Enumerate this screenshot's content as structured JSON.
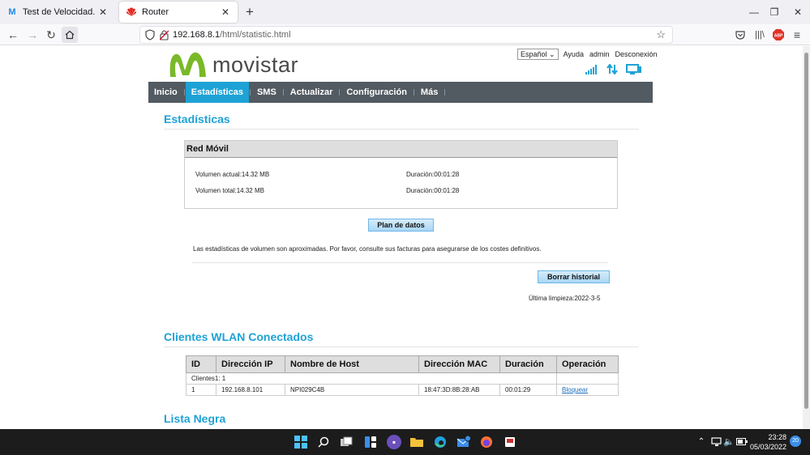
{
  "browser": {
    "tabs": [
      {
        "title": "Test de Velocidad. Comprueba",
        "active": false
      },
      {
        "title": "Router",
        "active": true
      }
    ],
    "url_host": "192.168.8.1",
    "url_path": "/html/statistic.html",
    "new_tab_glyph": "+",
    "close_glyph": "✕"
  },
  "header": {
    "logo_text": "movistar",
    "language": "Español",
    "links": [
      "Ayuda",
      "admin",
      "Desconexión"
    ]
  },
  "menu": {
    "items": [
      "Inicio",
      "Estadísticas",
      "SMS",
      "Actualizar",
      "Configuración",
      "Más"
    ],
    "active_index": 1
  },
  "stats": {
    "section_title": "Estadísticas",
    "box_title": "Red Móvil",
    "current_volume": "Volumen actual:14.32 MB",
    "current_duration": "Duración:00:01:28",
    "total_volume": "Volumen total:14.32 MB",
    "total_duration": "Duración:00:01:28",
    "plan_button": "Plan de datos",
    "note": "Las estadísticas de volumen son aproximadas. Por favor, consulte sus facturas para asegurarse de los costes definitivos.",
    "clear_button": "Borrar historial",
    "last_clean": "Última limpieza:2022-3-5"
  },
  "clients": {
    "section_title": "Clientes WLAN Conectados",
    "headers": [
      "ID",
      "Dirección IP",
      "Nombre de Host",
      "Dirección MAC",
      "Duración",
      "Operación"
    ],
    "summary": "Clientes1: 1",
    "rows": [
      {
        "id": "1",
        "ip": "192.168.8.101",
        "host": "NPI029C4B",
        "mac": "18:47:3D:8B:28:AB",
        "duration": "00:01:29",
        "action": "Bloquear"
      }
    ]
  },
  "blacklist": {
    "section_title": "Lista Negra"
  },
  "taskbar": {
    "time": "23:28",
    "date": "05/03/2022",
    "notification_count": "20"
  },
  "colors": {
    "accent": "#1ea2d6",
    "menubar": "#525a62",
    "logo_green": "#7ab929"
  }
}
